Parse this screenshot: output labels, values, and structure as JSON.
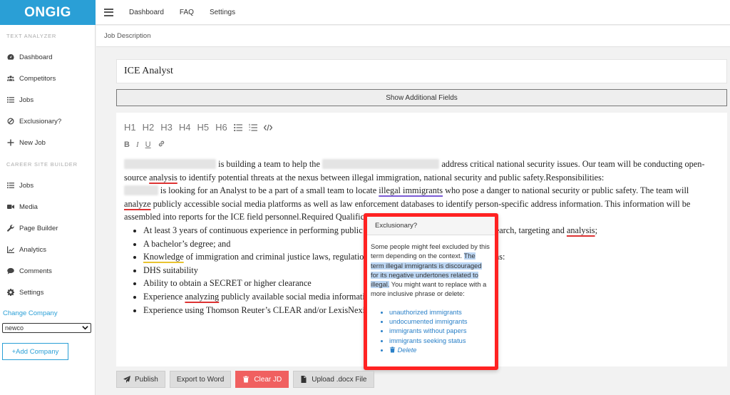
{
  "brand": {
    "logo": "ONGIG",
    "accent": "#2a9fd6"
  },
  "topnav": {
    "items": [
      "Dashboard",
      "FAQ",
      "Settings"
    ]
  },
  "sidebar": {
    "section1": "TEXT ANALYZER",
    "items1": [
      {
        "label": "Dashboard",
        "icon": "dashboard-icon"
      },
      {
        "label": "Competitors",
        "icon": "users-icon"
      },
      {
        "label": "Jobs",
        "icon": "list-icon"
      },
      {
        "label": "Exclusionary?",
        "icon": "ban-icon"
      },
      {
        "label": "New Job",
        "icon": "plus-icon"
      }
    ],
    "section2": "CAREER SITE BUILDER",
    "items2": [
      {
        "label": "Jobs",
        "icon": "list-icon"
      },
      {
        "label": "Media",
        "icon": "video-icon"
      },
      {
        "label": "Page Builder",
        "icon": "wrench-icon"
      },
      {
        "label": "Analytics",
        "icon": "chart-icon"
      },
      {
        "label": "Comments",
        "icon": "comment-icon"
      },
      {
        "label": "Settings",
        "icon": "gear-icon"
      }
    ],
    "change_company": "Change Company",
    "company": "newco",
    "add_company": "+Add Company"
  },
  "subheader": "Job Description",
  "job_title": "ICE Analyst",
  "show_fields": "Show Additional Fields",
  "toolbar": {
    "headings": [
      "H1",
      "H2",
      "H3",
      "H4",
      "H5",
      "H6"
    ]
  },
  "content": {
    "p1a": "is building a team to help the",
    "p1b": "address critical national security issues. Our team will be conducting open-source",
    "w_analysis": "analysis",
    "p1c": "to identify potential threats at the nexus between illegal immigration, national security and public safety.Responsibilities:",
    "p2a": "is looking for an Analyst to be a part of a small team to locate",
    "w_illegal": "illegal immigrants",
    "p2b": "who pose a danger to national security or public safety. The team will",
    "w_analyze": "analyze",
    "p2c": "publicly accessible social media platforms as well as law enforcement databases to identify person-specific address information. This information will be assembled into reports for the ICE field personnel.Required Qualifications:",
    "li1a": "At least 3 years of continuous experience in performing public records, open source information, research, targeting and",
    "li1b": ";",
    "li2": "A bachelor’s degree; and",
    "w_knowledge": "Knowledge",
    "li3": "of immigration and criminal justice laws, regulations and policies.Preferred Qualifications:",
    "li4": "DHS suitability",
    "li5": "Ability to obtain a SECRET or higher clearance",
    "li6a": "Experience",
    "w_analyzing": "analyzing",
    "li6b": "publicly available social media information",
    "li7": "Experience using Thomson Reuter’s CLEAR and/or LexisNexis"
  },
  "popover": {
    "title": "Exclusionary?",
    "text1": "Some people might feel excluded by this term depending on the context.",
    "highlight": "The term illegal immigrants is discouraged for its negative undertones related to illegal.",
    "text2": "You might want to replace with a more inclusive phrase or delete:",
    "suggestions": [
      "unauthorized immigrants",
      "undocumented immigrants",
      "immigrants without papers",
      "immigrants seeking status"
    ],
    "delete": "Delete"
  },
  "buttons": {
    "publish": "Publish",
    "export": "Export to Word",
    "clear": "Clear JD",
    "upload": "Upload .docx File"
  }
}
